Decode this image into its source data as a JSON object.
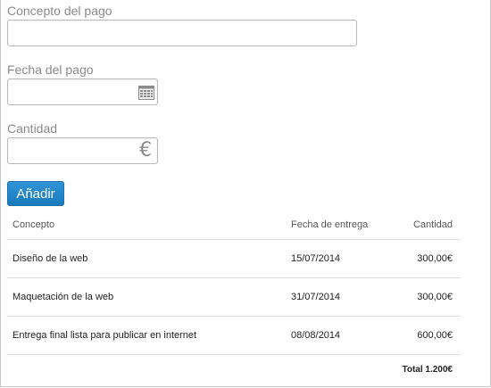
{
  "form": {
    "concept_label": "Concepto del pago",
    "concept_value": "",
    "date_label": "Fecha del pago",
    "date_value": "",
    "amount_label": "Cantidad",
    "amount_value": "",
    "add_button": "Añadir"
  },
  "icons": {
    "calendar": "calendar-icon",
    "currency": "€"
  },
  "colors": {
    "accent": "#1b79be",
    "label": "#8a8a8a",
    "border": "#b9b9b9"
  },
  "table": {
    "headers": [
      "Concepto",
      "Fecha de entrega",
      "Cantidad"
    ],
    "rows": [
      [
        "Diseño de la web",
        "15/07/2014",
        "300,00€"
      ],
      [
        "Maquetación de la web",
        "31/07/2014",
        "300,00€"
      ],
      [
        "Entrega final lista para publicar en internet",
        "08/08/2014",
        "600,00€"
      ]
    ],
    "total": "Total 1.200€"
  }
}
